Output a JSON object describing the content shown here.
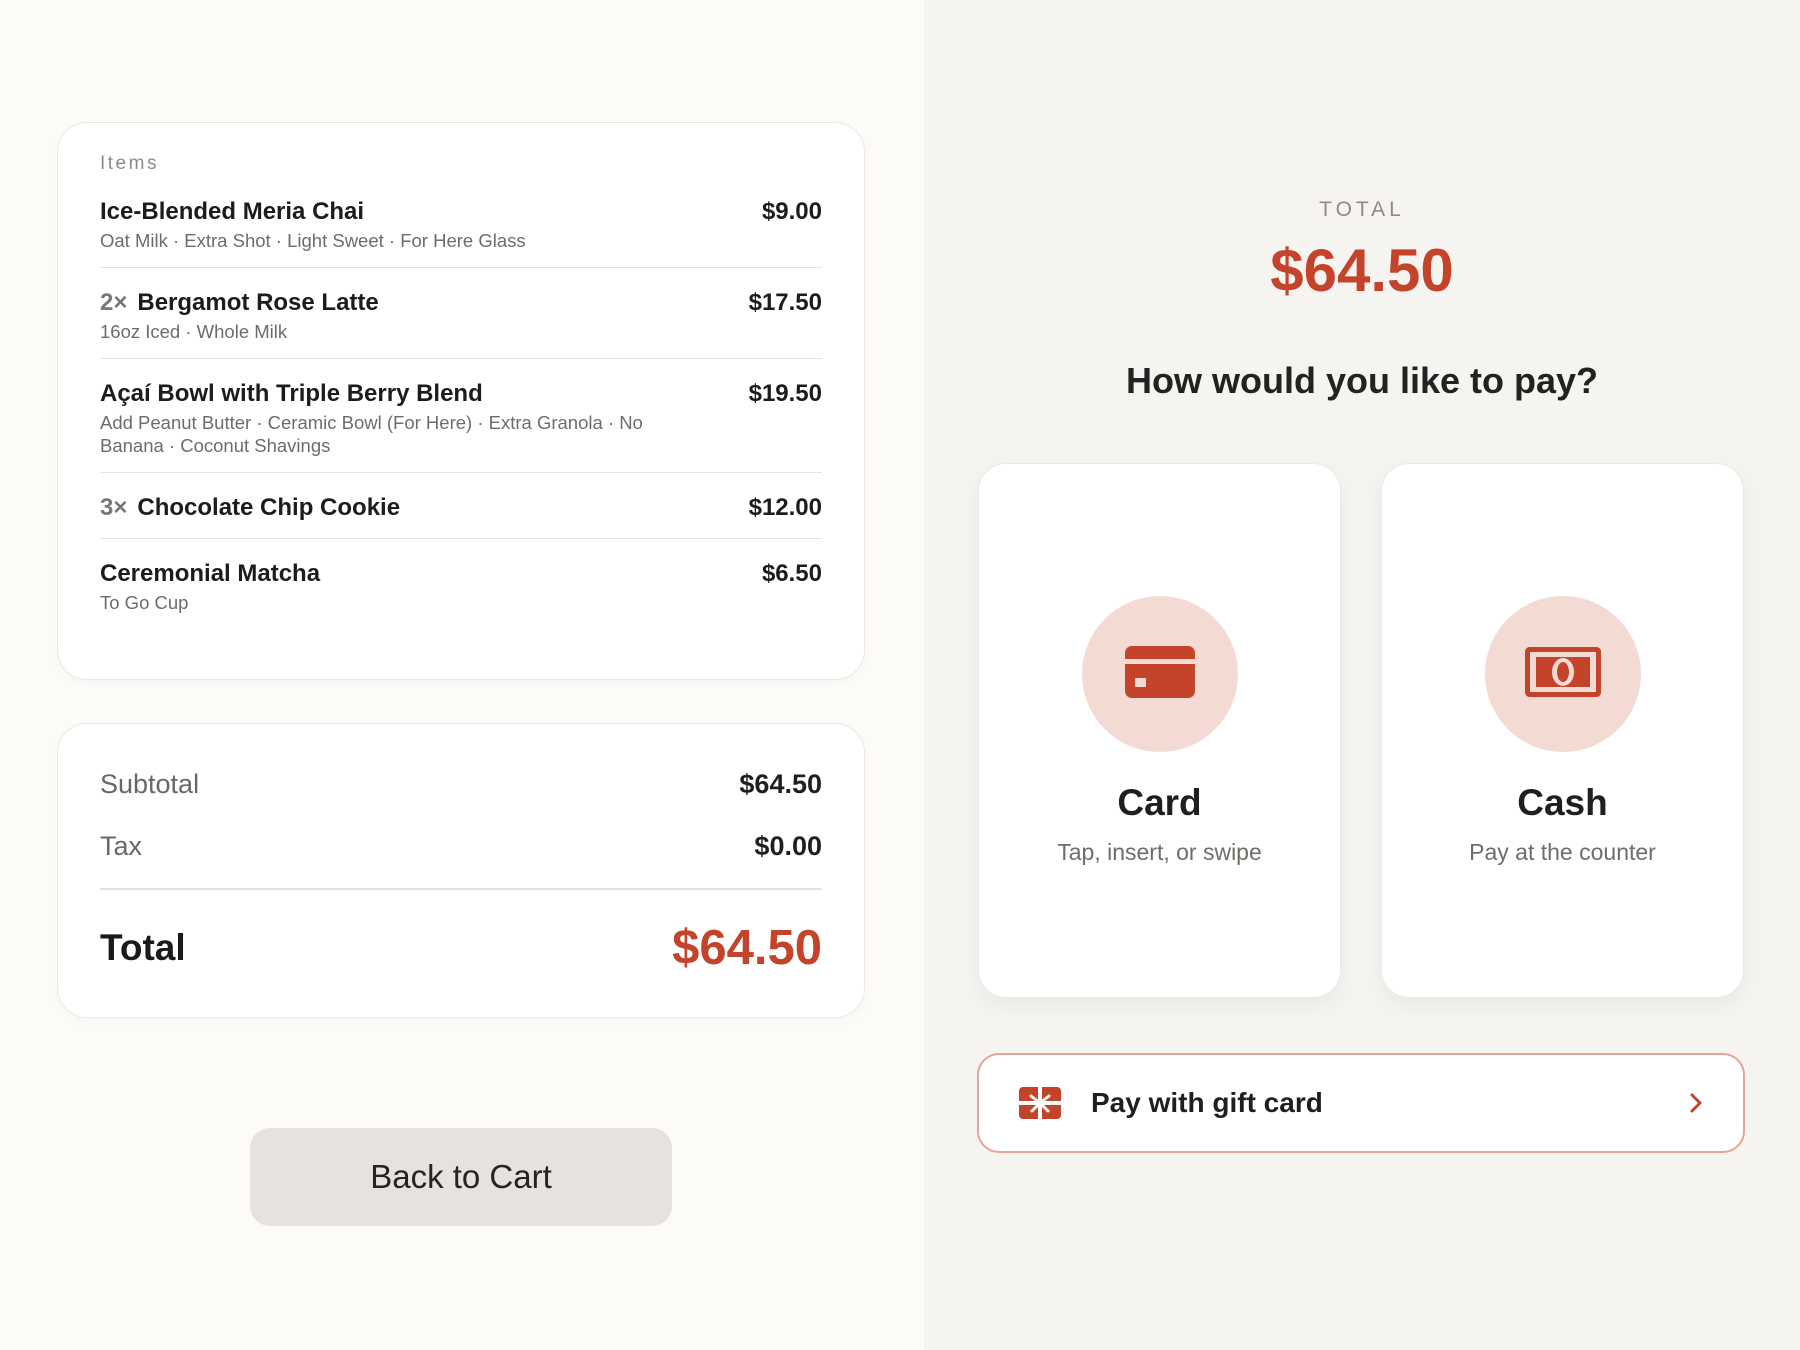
{
  "order": {
    "items_heading": "Items",
    "items": [
      {
        "qty": "",
        "name": "Ice-Blended Meria Chai",
        "mods": "Oat Milk · Extra Shot · Light Sweet · For Here Glass",
        "price": "$9.00"
      },
      {
        "qty": "2×",
        "name": "Bergamot Rose Latte",
        "mods": "16oz Iced · Whole Milk",
        "price": "$17.50"
      },
      {
        "qty": "",
        "name": "Açaí Bowl with Triple Berry Blend",
        "mods": "Add Peanut Butter · Ceramic Bowl (For Here) · Extra Granola · No Banana · Coconut Shavings",
        "price": "$19.50"
      },
      {
        "qty": "3×",
        "name": "Chocolate Chip Cookie",
        "mods": "",
        "price": "$12.00"
      },
      {
        "qty": "",
        "name": "Ceremonial Matcha",
        "mods": "To Go Cup",
        "price": "$6.50"
      }
    ]
  },
  "totals": {
    "subtotal_label": "Subtotal",
    "subtotal_value": "$64.50",
    "tax_label": "Tax",
    "tax_value": "$0.00",
    "total_label": "Total",
    "total_value": "$64.50"
  },
  "back_button": {
    "label": "Back to Cart"
  },
  "payment": {
    "total_caption": "TOTAL",
    "total_amount": "$64.50",
    "question": "How would you like to pay?",
    "methods": [
      {
        "title": "Card",
        "subtitle": "Tap, insert, or swipe",
        "icon": "credit-card-icon"
      },
      {
        "title": "Cash",
        "subtitle": "Pay at the counter",
        "icon": "cash-icon"
      }
    ],
    "gift_card": {
      "label": "Pay with gift card",
      "icon": "gift-card-icon"
    }
  },
  "colors": {
    "accent": "#c4432b",
    "icon_circle": "#f3dad3",
    "gift_border": "#e4a598",
    "back_button_bg": "#e6e3de",
    "left_bg": "#fcfbf8",
    "right_bg": "#f6f4f1"
  }
}
